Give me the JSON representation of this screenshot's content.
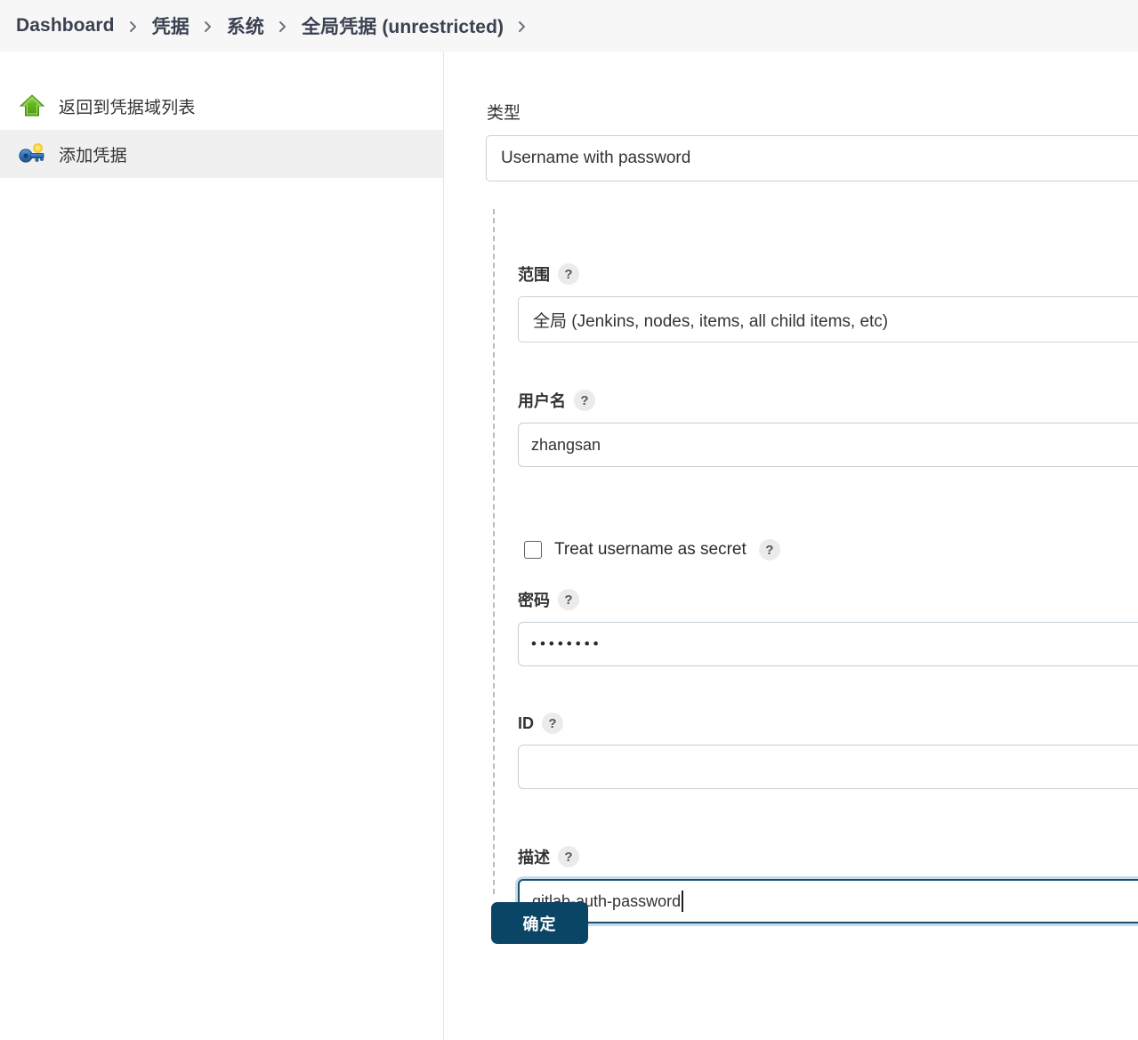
{
  "breadcrumb": {
    "items": [
      {
        "label": "Dashboard",
        "name": "breadcrumb-dashboard"
      },
      {
        "label": "凭据",
        "name": "breadcrumb-credentials"
      },
      {
        "label": "系统",
        "name": "breadcrumb-system"
      },
      {
        "label": "全局凭据 (unrestricted)",
        "name": "breadcrumb-global-credentials"
      }
    ],
    "separator_icon": "chevron-right-icon"
  },
  "sidebar": {
    "items": [
      {
        "label": "返回到凭据域列表",
        "icon": "up-arrow-icon",
        "active": false
      },
      {
        "label": "添加凭据",
        "icon": "key-icon",
        "active": true
      }
    ]
  },
  "form": {
    "type": {
      "label": "类型",
      "value": "Username with password"
    },
    "scope": {
      "label": "范围",
      "help": "?",
      "value": "全局 (Jenkins, nodes, items, all child items, etc)"
    },
    "username": {
      "label": "用户名",
      "help": "?",
      "value": "zhangsan"
    },
    "treat_username_as_secret": {
      "label": "Treat username as secret",
      "help": "?",
      "checked": false
    },
    "password": {
      "label": "密码",
      "help": "?",
      "value": "••••••••"
    },
    "id": {
      "label": "ID",
      "help": "?",
      "value": "",
      "placeholder": ""
    },
    "description": {
      "label": "描述",
      "help": "?",
      "value": "gitlab-auth-password",
      "focused": true
    },
    "submit": {
      "label": "确定"
    }
  },
  "colors": {
    "header_bg": "#f7f7f7",
    "sidebar_active_bg": "#f0f0f0",
    "button_bg": "#0b4566",
    "input_border": "#c4cfd7",
    "focus_border": "#1b4f6d",
    "focus_ring": "#c7dcea",
    "help_badge_bg": "#ebebeb"
  }
}
